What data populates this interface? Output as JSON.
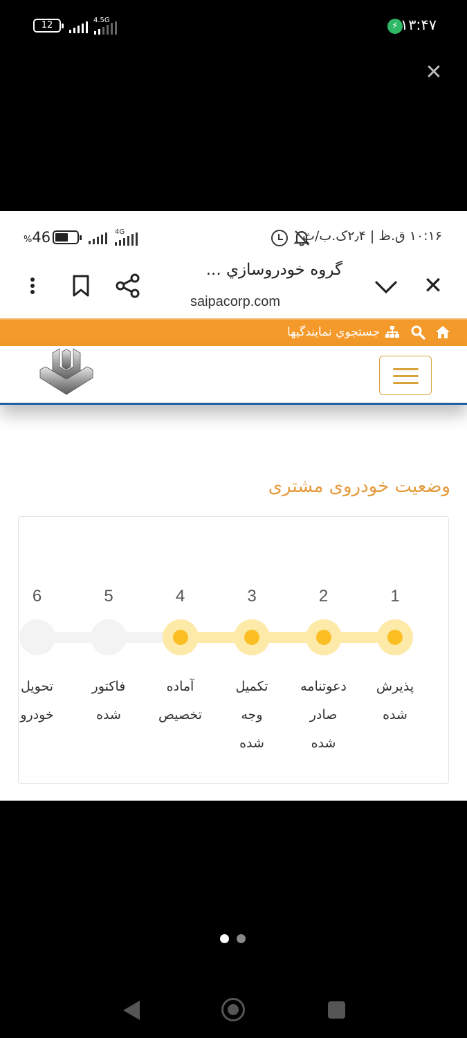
{
  "outer_status": {
    "battery": "12",
    "network": "4.5G",
    "time": "۱۳:۴۷"
  },
  "inner_status": {
    "time": "۱۰:۱۶ ق.ظ | ۲٫۴ک.ب/ث",
    "battery_pct": "46",
    "battery_unit": "%",
    "network": "4G"
  },
  "browser": {
    "title": "گروه خودروسازي ...",
    "url": "saipacorp.com"
  },
  "orange_bar": {
    "dealer_search": "جستجوي نمايندگيها"
  },
  "section_title": "وضعیت خودروی مشتری",
  "steps": [
    {
      "num": "1",
      "label": "پذیرش\nشده",
      "active": true
    },
    {
      "num": "2",
      "label": "دعوتنامه\nصادر\nشده",
      "active": true
    },
    {
      "num": "3",
      "label": "تکمیل\nوجه\nشده",
      "active": true
    },
    {
      "num": "4",
      "label": "آماده\nتخصیص",
      "active": true
    },
    {
      "num": "5",
      "label": "فاکتور\nشده",
      "active": false
    },
    {
      "num": "6",
      "label": "تحویل\nخودرو",
      "active": false
    }
  ],
  "colors": {
    "orange_bar": "#f39a2b",
    "accent_gold": "#e59a3b",
    "active_dot": "#fbbf24",
    "active_halo": "#fde9a8",
    "header_border": "#1c5fa8"
  },
  "pager": {
    "current": 1,
    "total": 2
  }
}
